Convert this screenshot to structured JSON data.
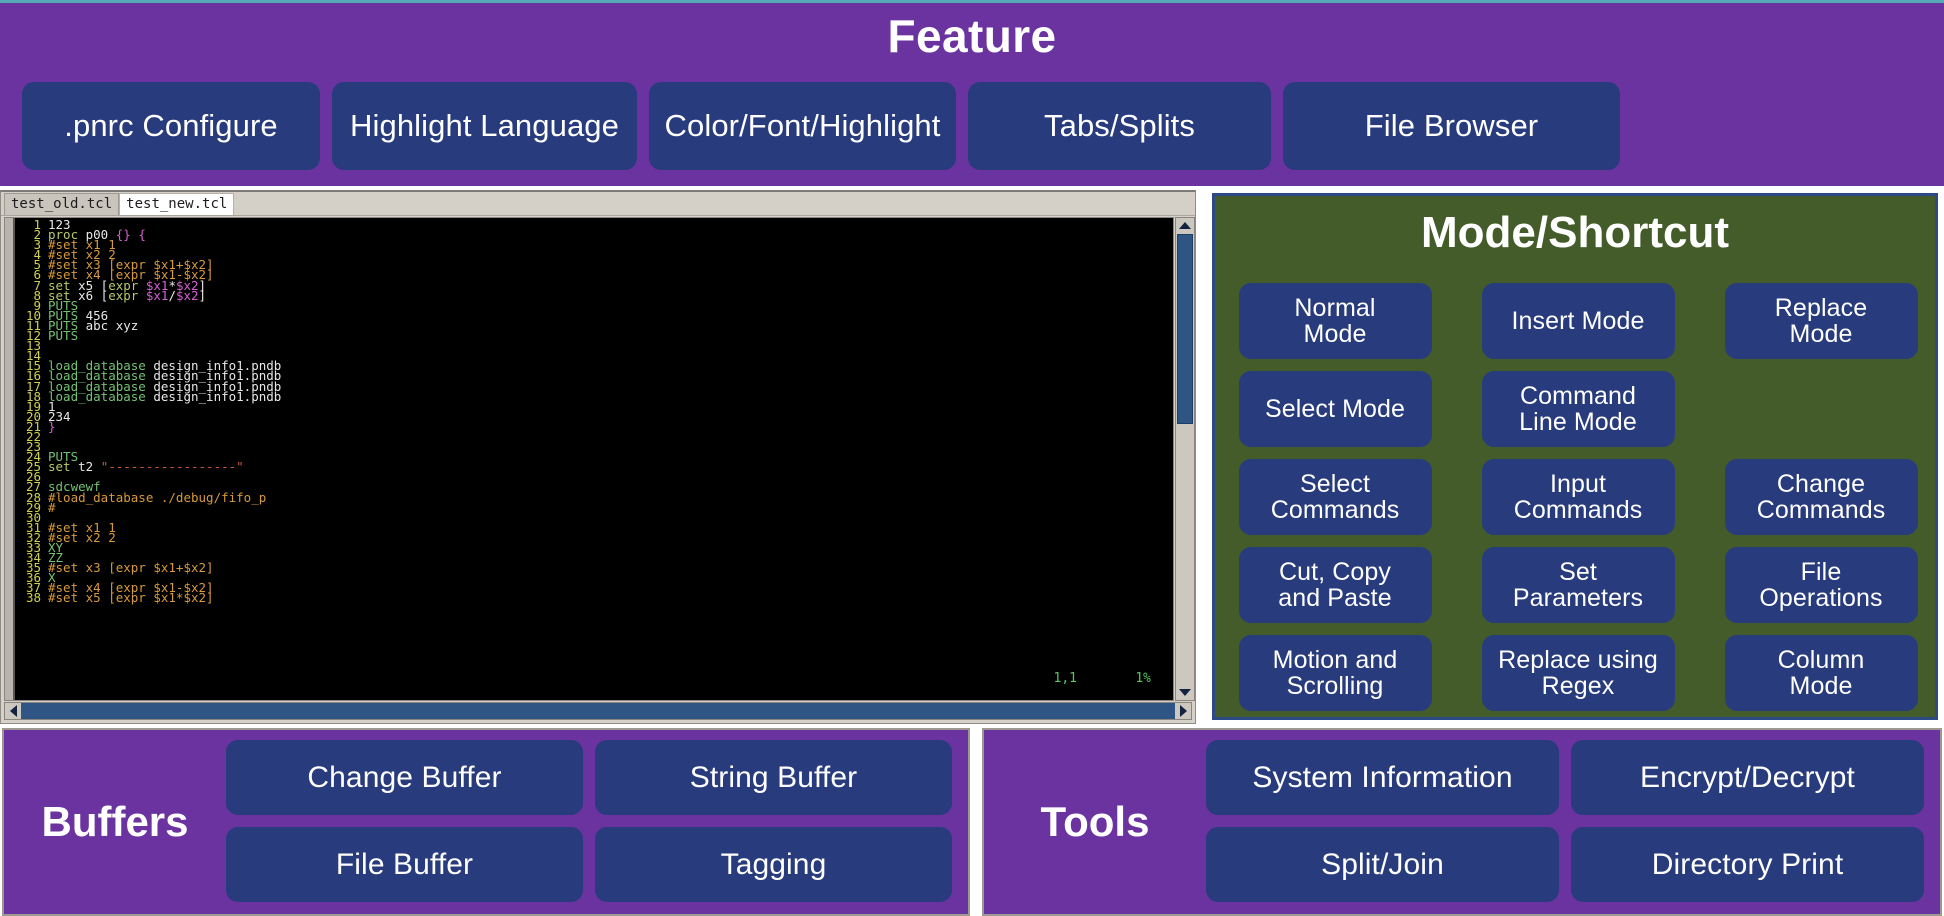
{
  "feature": {
    "title": "Feature",
    "buttons": [
      {
        "label": ".pnrc Configure"
      },
      {
        "label": "Highlight Language"
      },
      {
        "label": "Color/Font/Highlight"
      },
      {
        "label": "Tabs/Splits"
      },
      {
        "label": "File Browser"
      }
    ]
  },
  "editor": {
    "tabs": [
      {
        "label": "test_old.tcl",
        "active": false
      },
      {
        "label": "test_new.tcl",
        "active": true
      }
    ],
    "status": {
      "position": "1,1",
      "percent": "1%"
    },
    "lines": [
      {
        "n": "1",
        "text": "123"
      },
      {
        "n": "2",
        "text": "proc p00 {} {"
      },
      {
        "n": "3",
        "text": "#set x1 1"
      },
      {
        "n": "4",
        "text": "#set x2 2"
      },
      {
        "n": "5",
        "text": "#set x3 [expr $x1+$x2]"
      },
      {
        "n": "6",
        "text": "#set x4 [expr $x1-$x2]"
      },
      {
        "n": "7",
        "text": "set x5 [expr $x1*$x2]"
      },
      {
        "n": "8",
        "text": "set x6 [expr $x1/$x2]"
      },
      {
        "n": "9",
        "text": "PUTS"
      },
      {
        "n": "10",
        "text": "PUTS 456"
      },
      {
        "n": "11",
        "text": "PUTS abc xyz"
      },
      {
        "n": "12",
        "text": "PUTS"
      },
      {
        "n": "13",
        "text": ""
      },
      {
        "n": "14",
        "text": ""
      },
      {
        "n": "15",
        "text": "load_database design_info1.pndb"
      },
      {
        "n": "16",
        "text": "load_database design_info1.pndb"
      },
      {
        "n": "17",
        "text": "load_database design_info1.pndb"
      },
      {
        "n": "18",
        "text": "load_database design_info1.pndb"
      },
      {
        "n": "19",
        "text": "1"
      },
      {
        "n": "20",
        "text": "234"
      },
      {
        "n": "21",
        "text": "}"
      },
      {
        "n": "22",
        "text": ""
      },
      {
        "n": "23",
        "text": ""
      },
      {
        "n": "24",
        "text": "PUTS"
      },
      {
        "n": "25",
        "text": "set t2 \"-----------------\""
      },
      {
        "n": "26",
        "text": ""
      },
      {
        "n": "27",
        "text": "sdcwewf"
      },
      {
        "n": "28",
        "text": "#load_database ./debug/fifo_p"
      },
      {
        "n": "29",
        "text": "#"
      },
      {
        "n": "30",
        "text": ""
      },
      {
        "n": "31",
        "text": "#set x1 1"
      },
      {
        "n": "32",
        "text": "#set x2 2"
      },
      {
        "n": "33",
        "text": "XY"
      },
      {
        "n": "34",
        "text": "ZZ"
      },
      {
        "n": "35",
        "text": "#set x3 [expr $x1+$x2]"
      },
      {
        "n": "36",
        "text": "X"
      },
      {
        "n": "37",
        "text": "#set x4 [expr $x1-$x2]"
      },
      {
        "n": "38",
        "text": "#set x5 [expr $x1*$x2]"
      }
    ]
  },
  "mode": {
    "title": "Mode/Shortcut",
    "buttons": [
      {
        "label": "Normal\nMode"
      },
      {
        "label": "Insert Mode"
      },
      {
        "label": "Replace\nMode"
      },
      {
        "label": "Select Mode"
      },
      {
        "label": "Command\nLine Mode"
      },
      {
        "label": ""
      },
      {
        "label": "Select\nCommands"
      },
      {
        "label": "Input\nCommands"
      },
      {
        "label": "Change\nCommands"
      },
      {
        "label": "Cut, Copy\nand Paste"
      },
      {
        "label": "Set\nParameters"
      },
      {
        "label": "File\nOperations"
      },
      {
        "label": "Motion and\nScrolling"
      },
      {
        "label": "Replace using\nRegex"
      },
      {
        "label": "Column\nMode"
      }
    ]
  },
  "buffers": {
    "title": "Buffers",
    "buttons": [
      {
        "label": "Change Buffer"
      },
      {
        "label": "String Buffer"
      },
      {
        "label": "File Buffer"
      },
      {
        "label": "Tagging"
      }
    ]
  },
  "tools": {
    "title": "Tools",
    "buttons": [
      {
        "label": "System Information"
      },
      {
        "label": "Encrypt/Decrypt"
      },
      {
        "label": "Split/Join"
      },
      {
        "label": "Directory Print"
      }
    ]
  },
  "colors": {
    "purple": "#6a33a0",
    "button_blue": "#283b7c",
    "panel_green": "#435c2a",
    "panel_border_blue": "#2d4a87",
    "editor_bg": "#000000",
    "scrollbar_blue": "#2e5584",
    "status_green": "#5ec45e"
  }
}
